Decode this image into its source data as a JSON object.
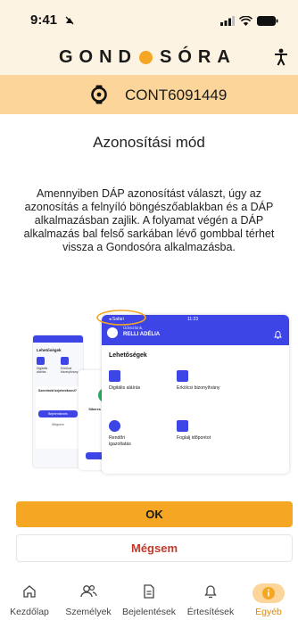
{
  "status": {
    "time": "9:41"
  },
  "brand": {
    "name_left": "GOND",
    "name_right": "SÓRA"
  },
  "account": {
    "code": "CONT6091449"
  },
  "page": {
    "title": "Azonosítási mód",
    "description": "Amennyiben DÁP azonosítást választ, úgy az azonosítás a felnyíló böngészőablakban és a DÁP alkalmazásban zajlik. A folyamat végén a DÁP alkalmazás bal felső sarkában lévő gombbal térhet vissza a Gondosóra alkalmazásba."
  },
  "illustration": {
    "back_label": "◂ Safari",
    "time": "11:23",
    "greeting": "Üdvözlünk,",
    "user_name": "RELLI ADÉLIA",
    "section_title": "Lehetőségek",
    "tiles": [
      "Digitális aláírás",
      "Erkölcsi bizonyítvány",
      "Rendőri igazoltatás",
      "Foglalj időpontot"
    ],
    "left_screen_title": "Lehetőségek",
    "left_small_tiles": [
      "Digitális aláírás",
      "Erkölcsi bizonyítvány"
    ],
    "left_question": "Szeretnéd bejelentkezni?",
    "left_button": "Bejelentkezés",
    "left_cancel": "Mégsem",
    "middle_text": "Sikeres bejelentkezés",
    "middle_button": "Tovább"
  },
  "actions": {
    "ok_label": "OK",
    "cancel_label": "Mégsem"
  },
  "tabbar": {
    "items": [
      {
        "label": "Kezdőlap",
        "icon": "home-icon"
      },
      {
        "label": "Személyek",
        "icon": "people-icon"
      },
      {
        "label": "Bejelentések",
        "icon": "document-icon"
      },
      {
        "label": "Értesítések",
        "icon": "bell-icon"
      },
      {
        "label": "Egyéb",
        "icon": "more-icon"
      }
    ]
  },
  "colors": {
    "accent": "#f5a623",
    "header_bg": "#fdf3e2",
    "code_bar_bg": "#fbd59a",
    "cancel_text": "#c0392b",
    "dap_blue": "#3d45e6"
  }
}
